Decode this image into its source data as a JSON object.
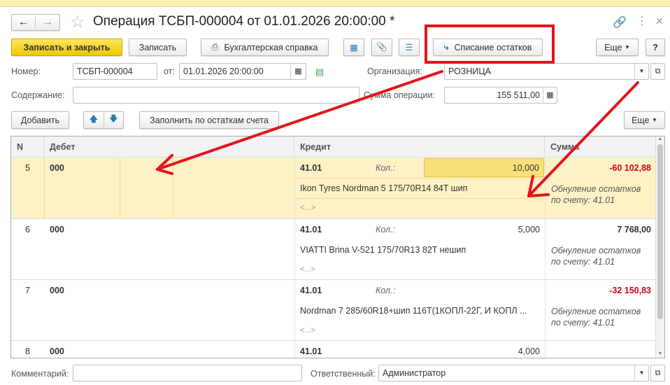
{
  "title": "Операция ТСБП-000004 от 01.01.2026 20:00:00 *",
  "toolbar": {
    "save_close": "Записать и закрыть",
    "save": "Записать",
    "report": "Бухгалтерская справка",
    "writeoff": "Списание остатков",
    "more": "Еще",
    "help": "?"
  },
  "form": {
    "number_label": "Номер:",
    "number": "ТСБП-000004",
    "date_label": "от:",
    "date": "01.01.2026 20:00:00",
    "org_label": "Организация:",
    "org": "РОЗНИЦА",
    "content_label": "Содержание:",
    "content": "",
    "sum_label": "Сумма операции:",
    "sum": "155 511,00"
  },
  "table_toolbar": {
    "add": "Добавить",
    "fill": "Заполнить по остаткам счета",
    "more": "Еще"
  },
  "columns": {
    "n": "N",
    "debit": "Дебет",
    "credit": "Кредит",
    "sum": "Сумма"
  },
  "rows": [
    {
      "n": "5",
      "debit": "000",
      "credit": "41.01",
      "qty_label": "Кол.:",
      "qty": "10,000",
      "sum": "-60 102,88",
      "item": "Ikon Tyres Nordman 5 175/70R14 84T шип",
      "sub": "<...>",
      "note": "Обнуление остатков по счету: 41.01"
    },
    {
      "n": "6",
      "debit": "000",
      "credit": "41.01",
      "qty_label": "Кол.:",
      "qty": "5,000",
      "sum": "7 768,00",
      "item": "VIATTI Brina V-521 175/70R13 82T нешип",
      "sub": "<...>",
      "note": "Обнуление остатков по счету: 41.01"
    },
    {
      "n": "7",
      "debit": "000",
      "credit": "41.01",
      "qty_label": "Кол.:",
      "qty": "",
      "sum": "-32 150,83",
      "item": "Nordman 7 285/60R18+шип 116T(1КОПЛ-22Г, И КОПЛ ...",
      "sub": "<...>",
      "note": "Обнуление остатков по счету: 41.01"
    },
    {
      "n": "8",
      "debit": "000",
      "credit": "41.01",
      "qty_label": "",
      "qty": "4,000",
      "sum": "",
      "item": "",
      "sub": "",
      "note": ""
    }
  ],
  "footer": {
    "comment_label": "Комментарий:",
    "comment": "",
    "resp_label": "Ответственный:",
    "resp": "Администратор"
  }
}
